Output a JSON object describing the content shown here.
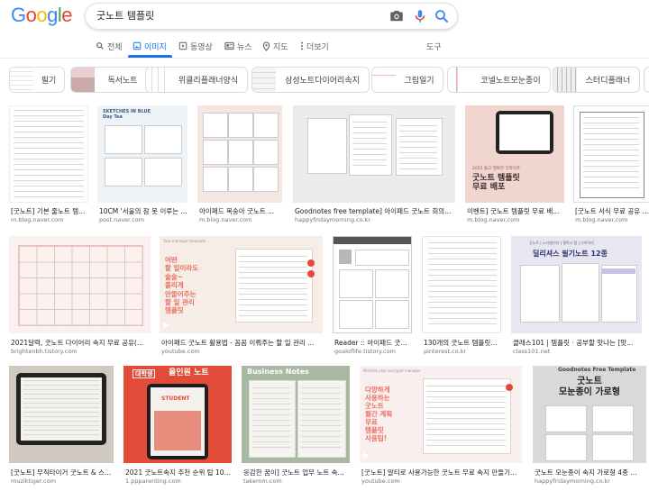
{
  "logo": {
    "letters": [
      "G",
      "o",
      "o",
      "g",
      "l",
      "e"
    ],
    "colors": [
      "#4285f4",
      "#ea4335",
      "#fbbc05",
      "#4285f4",
      "#34a853",
      "#ea4335"
    ]
  },
  "search": {
    "query": "굿노트 템플릿"
  },
  "tabs": [
    {
      "label": "전체",
      "icon": "search-icon"
    },
    {
      "label": "이미지",
      "icon": "image-icon",
      "active": true
    },
    {
      "label": "동영상",
      "icon": "play-icon"
    },
    {
      "label": "뉴스",
      "icon": "news-icon"
    },
    {
      "label": "지도",
      "icon": "map-pin-icon"
    },
    {
      "label": "더보기",
      "icon": "more-icon"
    }
  ],
  "tools_label": "도구",
  "chips": [
    "필기",
    "독서노트",
    "위클리플래너양식",
    "삼성노트다이어리속지",
    "그림일기",
    "코넬노트모눈종이",
    "스터디플래너"
  ],
  "overlays": {
    "r1c2": "SKETCHES IN BLUE\nDay Tea",
    "r1c5": "굿노트 템플릿\n무료 배포",
    "r1c5_small": "2021 불고 행복한 굿라이프",
    "r2c2_head": "Task manager template",
    "r2c2": "어떤\n할 일이라도\n술술~\n풀리게\n만들어주는\n할 일 관리\n템플릿",
    "r2c5_small": "굿노트 | 노타빌리티 | 갤럭시 탭 | 다이어리",
    "r2c5": "딜리셔스 필기노트 12종",
    "r3c2_tag": "대학생",
    "r3c2": "올인원 노트",
    "r3c2_student": "STUDENT",
    "r3c3": "Business Notes",
    "r3c4_head": "Monthly plan and goal manager",
    "r3c4": "다양하게\n사용하는\n굿노트\n월간 계획\n무료\n템플릿\n사용팁!",
    "r3c5_top": "Goodnotes Free Template",
    "r3c5": "굿노트\n모눈종이 가로형"
  },
  "results": [
    {
      "title": "[굿노트] 기본 줄노트 템...",
      "source": "m.blog.naver.com"
    },
    {
      "title": "10CM '서울의 잠 못 이루는 ...",
      "source": "post.naver.com"
    },
    {
      "title": "아이패드 복숭아 굿노트 ...",
      "source": "m.blog.naver.com"
    },
    {
      "title": "Goodnotes free template] 아이패드 굿노트 회의록 ...",
      "source": "happyfridaymorning.co.kr"
    },
    {
      "title": "이벤트] 굿노트 템플릿 무료 배...",
      "source": "m.blog.naver.com"
    },
    {
      "title": "[굿노트 서식 무료 공유 / 굿노트 ...",
      "source": "m.blog.naver.com"
    },
    {
      "title": "2021달력, 굿노트 다이어리 속지 무료 공유(...",
      "source": "brightenbh.tistory.com"
    },
    {
      "title": "아이패드 굿노트 활용법 - 꼼꼼 이뤄주는 할 일 관리 ...",
      "source": "youtube.com"
    },
    {
      "title": "Reader :: 아이패드 굿노...",
      "source": "goaloflife.tistory.com"
    },
    {
      "title": "130개의 굿노트 템플릿...",
      "source": "pinterest.co.kr"
    },
    {
      "title": "클래스101 | 템플릿 · 공부할 맛나는 [맛...",
      "source": "class101.net"
    },
    {
      "title": "[굿노트] 무직타이거 굿노트 & 스...",
      "source": "muziktiger.com"
    },
    {
      "title": "2021 굿노트속지 추천 순위 탑 10 ...",
      "source": "1.ppparenting.com"
    },
    {
      "title": "응감한 꿈이] 굿노트 업무 노트 속...",
      "source": "takemm.com"
    },
    {
      "title": "[굿노트] 알티로 사용가능한 굿노트 무료 속지 만들기...",
      "source": "youtube.com"
    },
    {
      "title": "굿노트 모눈종이 속지 가로형 4종 ...",
      "source": "happyfridaymorning.co.kr"
    }
  ],
  "colors": {
    "accent": "#1a73e8",
    "source_gray": "#70757a",
    "coral": "#e8705f"
  }
}
